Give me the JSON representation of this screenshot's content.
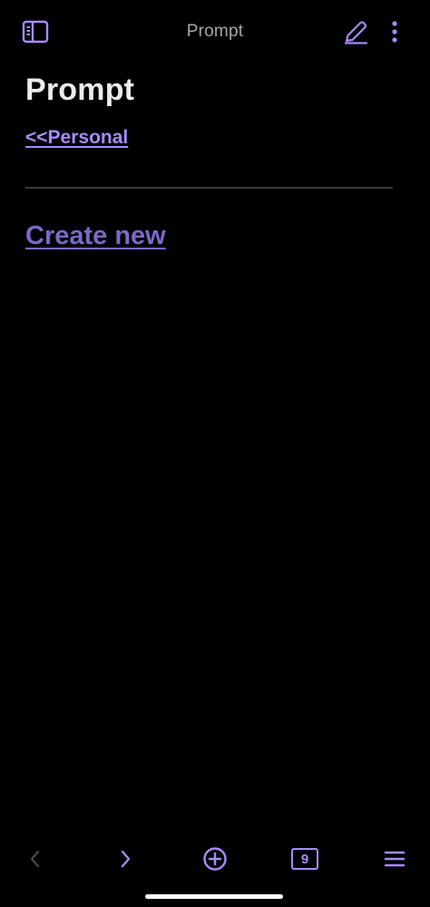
{
  "header": {
    "title": "Prompt"
  },
  "note": {
    "title": "Prompt",
    "back_link": "<<Personal",
    "create_link": "Create new"
  },
  "toolbar": {
    "tabs_count": "9"
  },
  "colors": {
    "accent": "#a78bfa",
    "accent_dim": "#7d68c7",
    "background": "#000000"
  },
  "icons": {
    "sidebar": "sidebar-icon",
    "edit": "pencil-icon",
    "more": "more-vertical-icon",
    "back": "chevron-left-icon",
    "forward": "chevron-right-icon",
    "new": "plus-circle-icon",
    "tabs": "tabs-icon",
    "menu": "menu-icon"
  }
}
